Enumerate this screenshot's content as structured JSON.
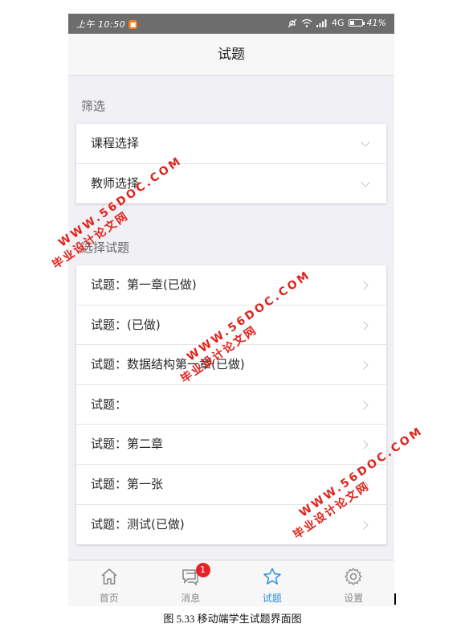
{
  "status_bar": {
    "time": "上午 10:50",
    "app_badge": "■",
    "network": "4G",
    "battery": "41%",
    "battery_fraction": 0.41
  },
  "navbar": {
    "title": "试题"
  },
  "filter": {
    "section_title": "筛选",
    "rows": [
      {
        "label": "课程选择"
      },
      {
        "label": "教师选择"
      }
    ]
  },
  "exams": {
    "section_title": "选择试题",
    "rows": [
      {
        "label": "试题：第一章(已做)"
      },
      {
        "label": "试题：(已做)"
      },
      {
        "label": "试题：数据结构第一章(已做)"
      },
      {
        "label": "试题："
      },
      {
        "label": "试题：第二章"
      },
      {
        "label": "试题：第一张"
      },
      {
        "label": "试题：测试(已做)"
      }
    ]
  },
  "tabbar": {
    "tabs": [
      {
        "label": "首页",
        "icon": "home-icon"
      },
      {
        "label": "消息",
        "icon": "message-icon",
        "badge": "1"
      },
      {
        "label": "试题",
        "icon": "star-icon",
        "active": true
      },
      {
        "label": "设置",
        "icon": "gear-icon"
      }
    ],
    "active_color": "#2e8fe8"
  },
  "watermark": {
    "name": "毕业设计论文网",
    "url": "WWW.56DOC.COM",
    "color": "#e0231c"
  },
  "caption": "图 5.33  移动端学生试题界面图"
}
